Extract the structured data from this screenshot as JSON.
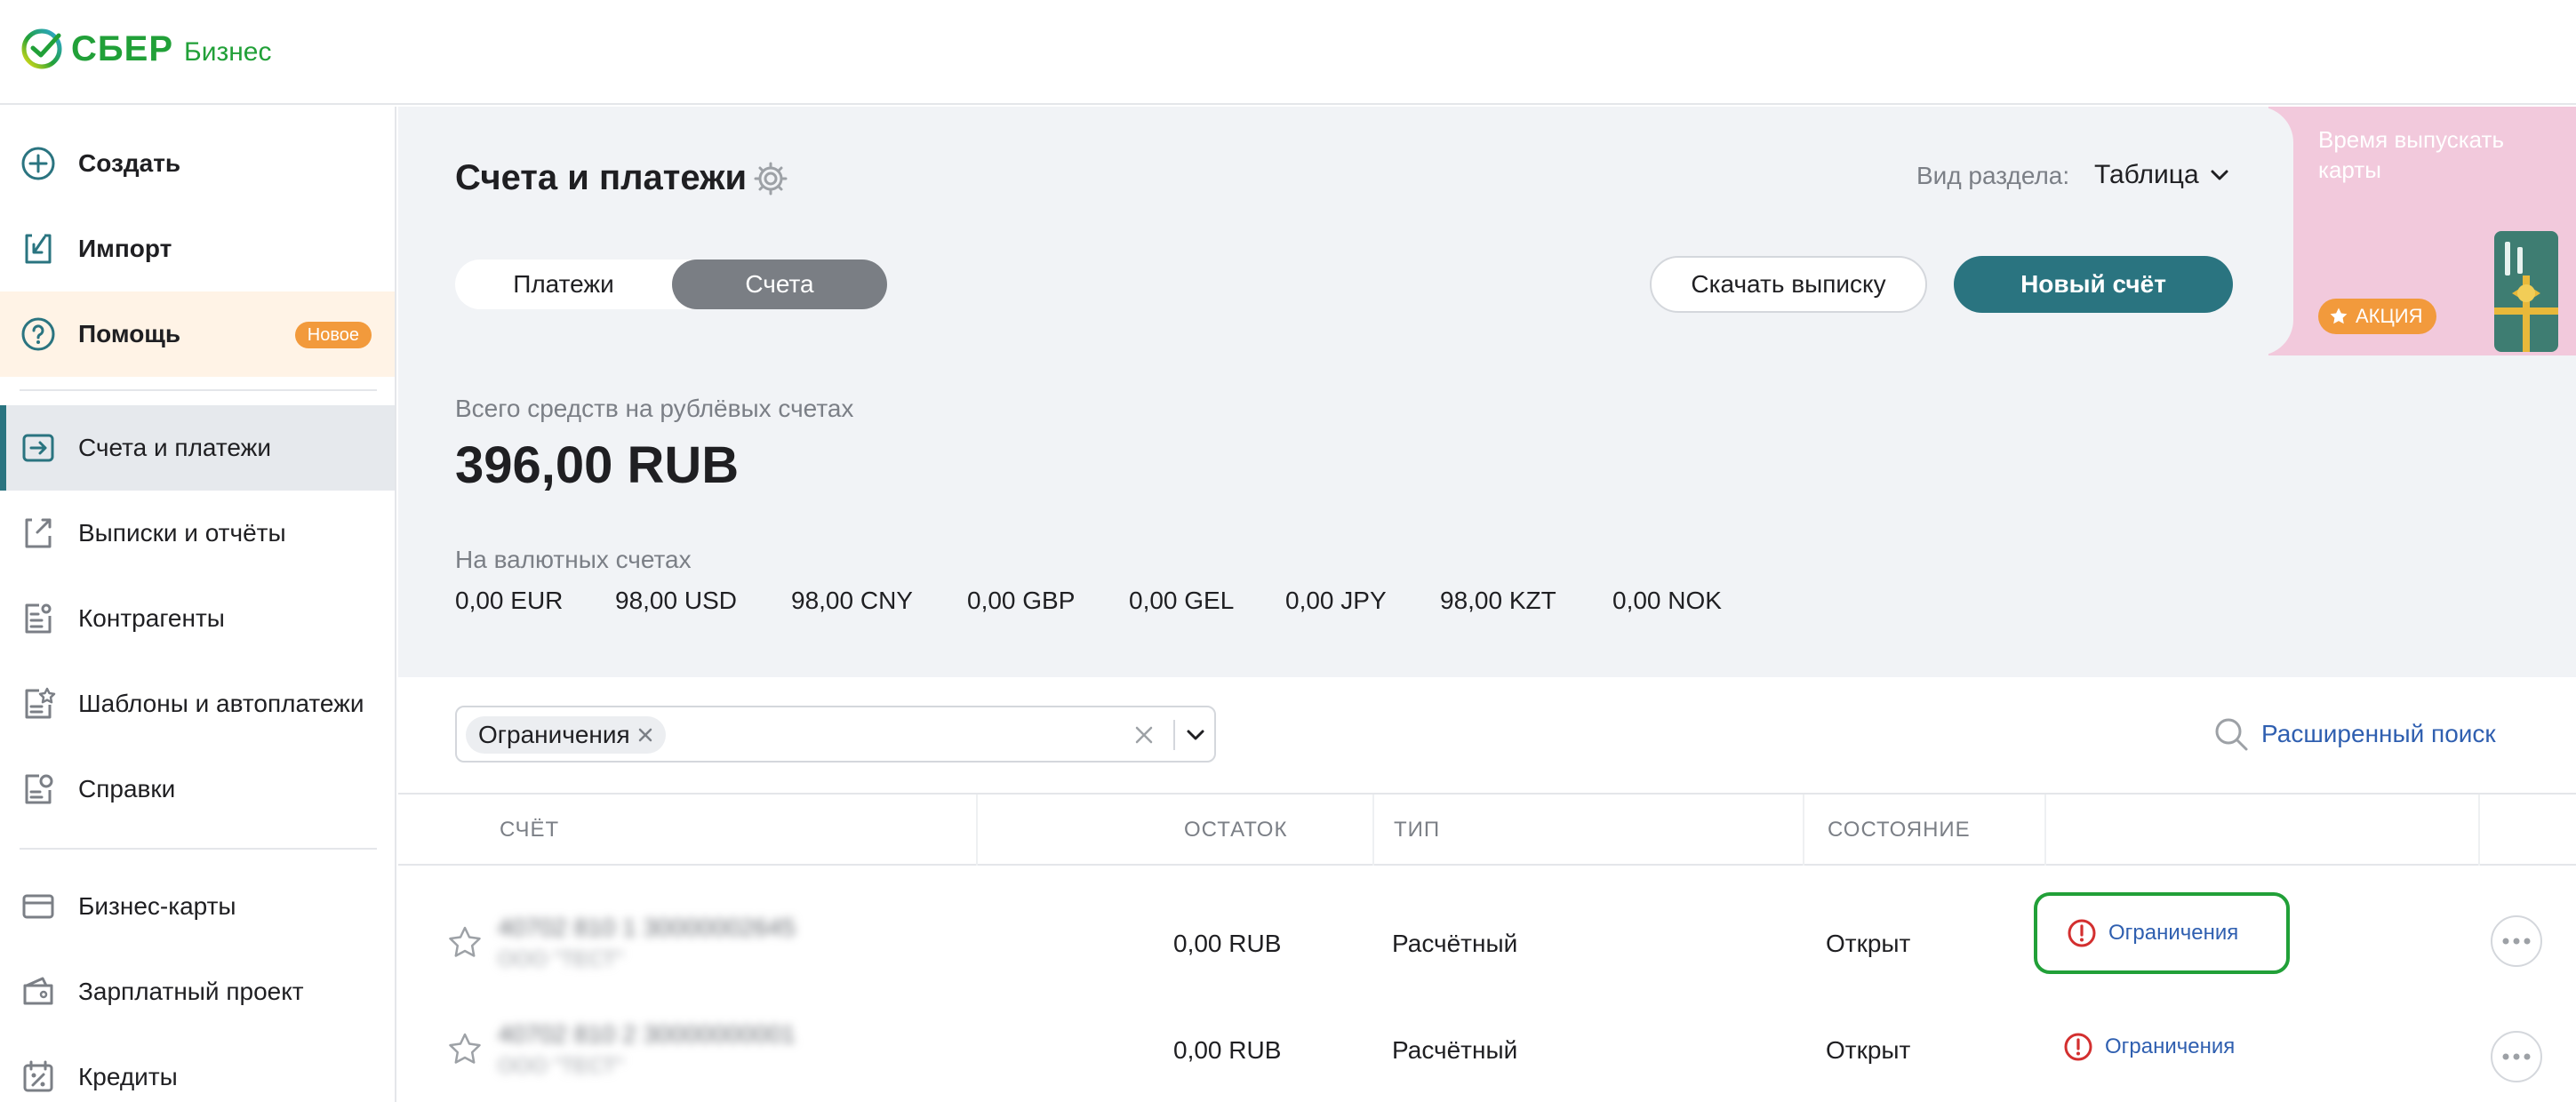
{
  "brand": {
    "name": "СБЕР",
    "product": "Бизнес",
    "color": "#21a038"
  },
  "sidebar": {
    "items": [
      {
        "label": "Создать",
        "icon": "plus-circle-icon"
      },
      {
        "label": "Импорт",
        "icon": "import-icon"
      },
      {
        "label": "Помощь",
        "icon": "help-icon",
        "badge": "Новое"
      },
      {
        "label": "Счета и платежи",
        "icon": "accounts-icon",
        "active": true
      },
      {
        "label": "Выписки и отчёты",
        "icon": "reports-icon"
      },
      {
        "label": "Контрагенты",
        "icon": "counterparties-icon"
      },
      {
        "label": "Шаблоны и автоплатежи",
        "icon": "templates-icon"
      },
      {
        "label": "Справки",
        "icon": "certificates-icon"
      },
      {
        "label": "Бизнес-карты",
        "icon": "card-icon"
      },
      {
        "label": "Зарплатный проект",
        "icon": "wallet-icon"
      },
      {
        "label": "Кредиты",
        "icon": "credit-percent-icon"
      }
    ]
  },
  "header": {
    "title": "Счета и платежи",
    "view_label": "Вид раздела:",
    "view_value": "Таблица"
  },
  "tabs": [
    {
      "label": "Платежи",
      "selected": false
    },
    {
      "label": "Счета",
      "selected": true
    }
  ],
  "actions": {
    "download_label": "Скачать выписку",
    "new_label": "Новый счёт",
    "accent": "#2a7480"
  },
  "promo": {
    "text": "Время выпускать карты",
    "badge": "АКЦИЯ"
  },
  "totals": {
    "rub_label": "Всего средств на рублёвых счетах",
    "rub_value": "396,00 RUB",
    "fx_label": "На валютных счетах",
    "fx": [
      "0,00 EUR",
      "98,00 USD",
      "98,00 CNY",
      "0,00 GBP",
      "0,00 GEL",
      "0,00 JPY",
      "98,00 KZT",
      "0,00 NOK"
    ]
  },
  "filter": {
    "chip": "Ограничения",
    "advanced_search": "Расширенный поиск"
  },
  "table": {
    "columns": [
      "СЧЁТ",
      "ОСТАТОК",
      "ТИП",
      "СОСТОЯНИЕ"
    ],
    "rows": [
      {
        "account": "40702 810 1 30000002645",
        "owner": "ООО \"ТЕСТ\"",
        "balance": "0,00 RUB",
        "type": "Расчётный",
        "status": "Открыт",
        "restriction": "Ограничения"
      },
      {
        "account": "40702 810 2 30000000001",
        "owner": "ООО \"ТЕСТ\"",
        "balance": "0,00 RUB",
        "type": "Расчётный",
        "status": "Открыт",
        "restriction": "Ограничения"
      }
    ]
  },
  "colors": {
    "link": "#2f5fb0",
    "warning": "#d32f2f",
    "badge": "#f29a3c",
    "promo_bg": "#f2c9dc"
  }
}
